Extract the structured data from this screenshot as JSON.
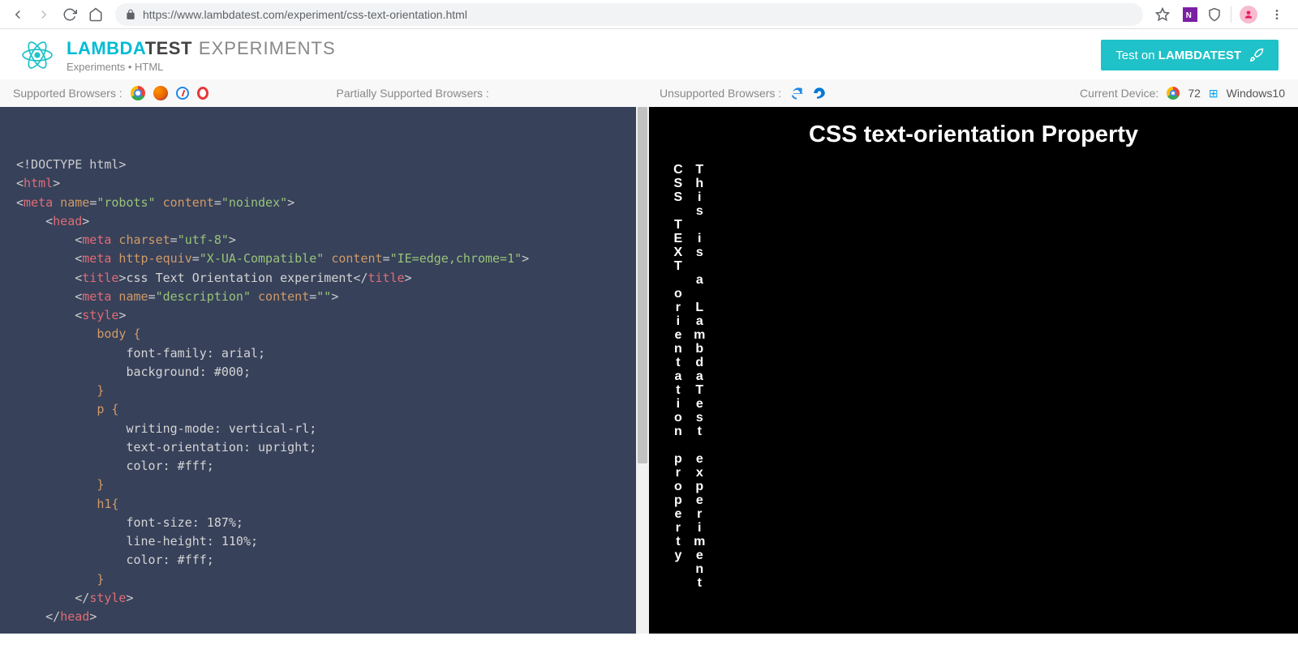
{
  "browser": {
    "url": "https://www.lambdatest.com/experiment/css-text-orientation.html"
  },
  "header": {
    "brand1": "LAMBDA",
    "brand2": "TEST",
    "brand3": "EXPERIMENTS",
    "sub": "Experiments • HTML",
    "cta_prefix": "Test on ",
    "cta_bold": "LAMBDATEST"
  },
  "support": {
    "label_supported": "Supported Browsers :",
    "label_partial": "Partially Supported Browsers :",
    "label_unsupported": "Unsupported Browsers :",
    "label_device": "Current Device:",
    "chrome_ver": "72",
    "os": "Windows10"
  },
  "code": {
    "l1": "<!DOCTYPE html>",
    "l2a": "<",
    "l2b": "html",
    "l2c": ">",
    "l3a": "<",
    "l3b": "meta",
    "l3c": " name",
    "l3d": "=",
    "l3e": "\"robots\"",
    "l3f": " content",
    "l3g": "=",
    "l3h": "\"noindex\"",
    "l3i": ">",
    "l4a": "    <",
    "l4b": "head",
    "l4c": ">",
    "l5a": "        <",
    "l5b": "meta",
    "l5c": " charset",
    "l5d": "=",
    "l5e": "\"utf-8\"",
    "l5f": ">",
    "l6a": "        <",
    "l6b": "meta",
    "l6c": " http-equiv",
    "l6d": "=",
    "l6e": "\"X-UA-Compatible\"",
    "l6f": " content",
    "l6g": "=",
    "l6h": "\"IE=edge,chrome=1\"",
    "l6i": ">",
    "l7a": "        <",
    "l7b": "title",
    "l7c": ">",
    "l7d": "css Text Orientation experiment",
    "l7e": "</",
    "l7f": "title",
    "l7g": ">",
    "l8a": "        <",
    "l8b": "meta",
    "l8c": " name",
    "l8d": "=",
    "l8e": "\"description\"",
    "l8f": " content",
    "l8g": "=",
    "l8h": "\"\"",
    "l8i": ">",
    "l9a": "        <",
    "l9b": "style",
    "l9c": ">",
    "c1": "           body {",
    "c2": "               font-family: arial;",
    "c3": "               background: #000;",
    "c4": "           }",
    "c5": "           p {",
    "c6": "               writing-mode: vertical-rl;",
    "c7": "               text-orientation: upright;",
    "c8": "               color: #fff;",
    "c9": "           }",
    "c10": "           h1{",
    "c11": "               font-size: 187%;",
    "c12": "               line-height: 110%;",
    "c13": "               color: #fff;",
    "c14": "           }",
    "l10a": "        </",
    "l10b": "style",
    "l10c": ">",
    "l11a": "    </",
    "l11b": "head",
    "l11c": ">"
  },
  "preview": {
    "heading": "CSS text-orientation Property",
    "p1": "CSS TEXT orientation property",
    "p2": "This is a LambdaTest experiment"
  }
}
